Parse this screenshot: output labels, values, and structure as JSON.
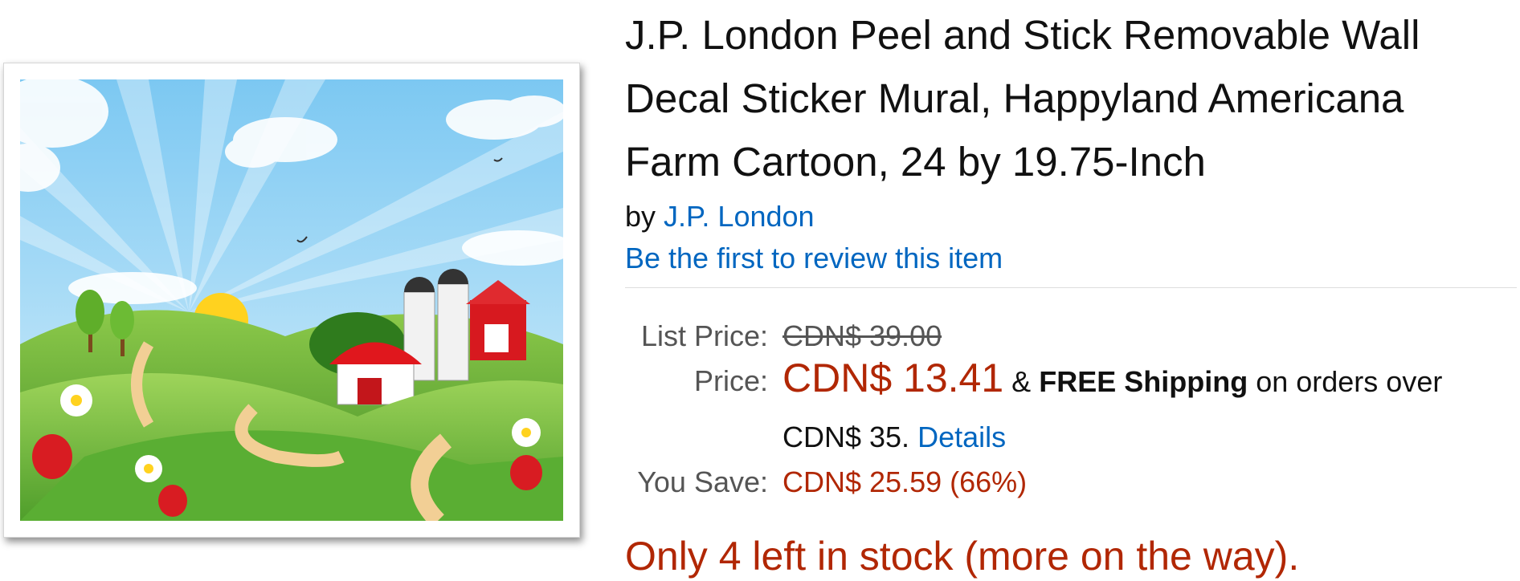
{
  "product": {
    "title_lines": [
      "J.P. London Peel and Stick Removable Wall",
      "Decal Sticker Mural, Happyland Americana",
      "Farm Cartoon, 24 by 19.75-Inch"
    ],
    "by_prefix": "by",
    "brand": "J.P. London",
    "review_link": "Be the first to review this item"
  },
  "pricing": {
    "list_price_label": "List Price:",
    "list_price_value": "CDN$ 39.00",
    "price_label": "Price:",
    "price_value": "CDN$ 13.41",
    "shipping_amp": "&",
    "shipping_bold": "FREE Shipping",
    "shipping_rest": "on orders over",
    "shipping_threshold": "CDN$ 35.",
    "details_link": "Details",
    "you_save_label": "You Save:",
    "you_save_value": "CDN$ 25.59 (66%)"
  },
  "availability": {
    "stock_text": "Only 4 left in stock (more on the way)."
  },
  "colors": {
    "link": "#0066c0",
    "price_red": "#b12704",
    "label_gray": "#555555"
  },
  "image": {
    "icon": "farm-landscape-image"
  }
}
